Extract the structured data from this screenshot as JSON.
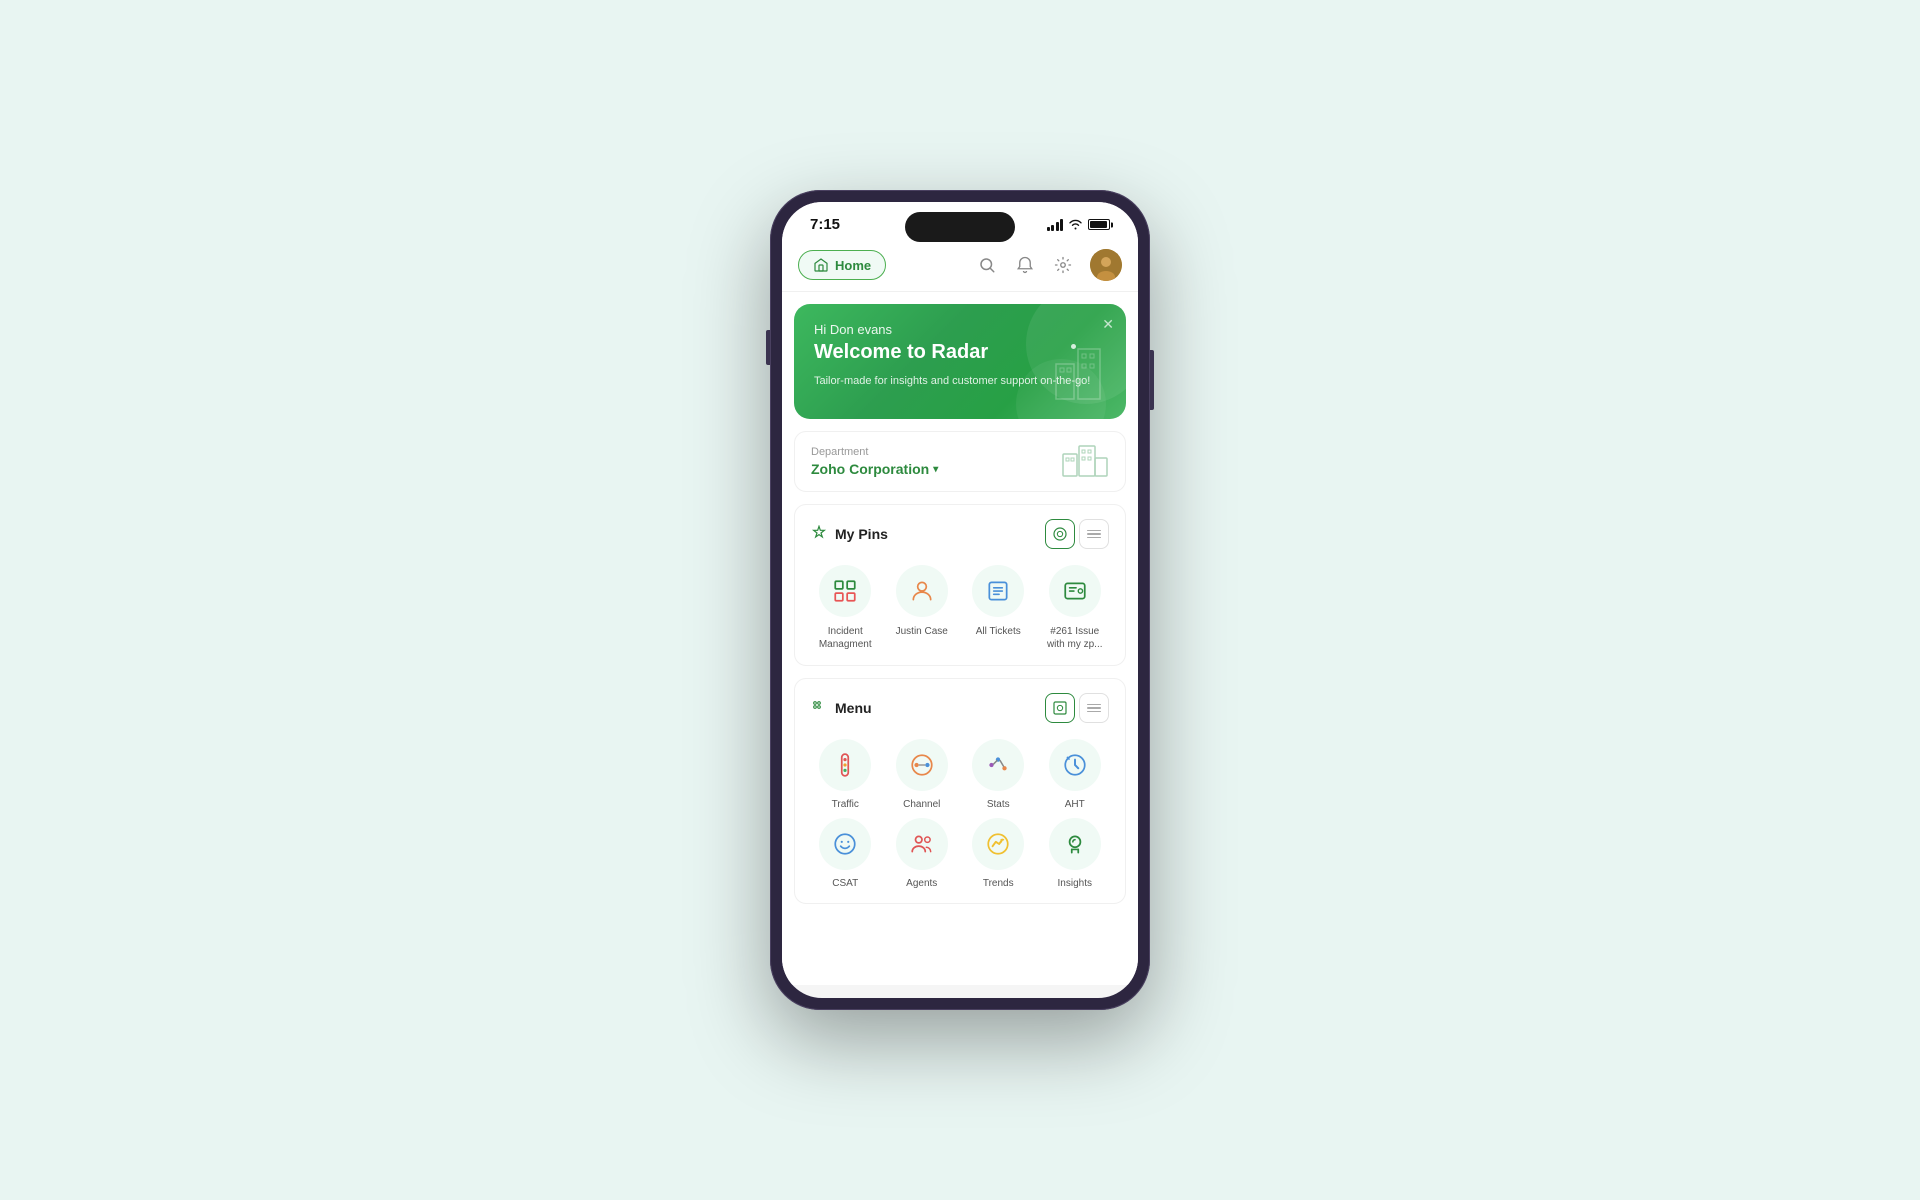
{
  "phone": {
    "time": "7:15",
    "background": "#e8f5f2"
  },
  "nav": {
    "home_label": "Home",
    "icons": [
      "search",
      "bell",
      "gear"
    ],
    "avatar_alt": "User avatar"
  },
  "banner": {
    "greeting": "Hi Don evans",
    "title": "Welcome to Radar",
    "subtitle": "Tailor-made for insights and customer support on-the-go!"
  },
  "department": {
    "label": "Department",
    "name": "Zoho Corporation",
    "chevron": "▾"
  },
  "pins": {
    "section_title": "My Pins",
    "items": [
      {
        "label": "Incident Managment",
        "icon": "grid"
      },
      {
        "label": "Justin Case",
        "icon": "person"
      },
      {
        "label": "All Tickets",
        "icon": "folder"
      },
      {
        "label": "#261 Issue with my zp...",
        "icon": "ticket"
      }
    ]
  },
  "menu": {
    "section_title": "Menu",
    "items": [
      {
        "label": "Traffic",
        "icon": "traffic"
      },
      {
        "label": "Channel",
        "icon": "channel"
      },
      {
        "label": "Stats",
        "icon": "stats"
      },
      {
        "label": "AHT",
        "icon": "aht"
      },
      {
        "label": "CSAT",
        "icon": "csat"
      },
      {
        "label": "Agents",
        "icon": "agents"
      },
      {
        "label": "Trends",
        "icon": "trends"
      },
      {
        "label": "Insights",
        "icon": "insights"
      }
    ]
  }
}
